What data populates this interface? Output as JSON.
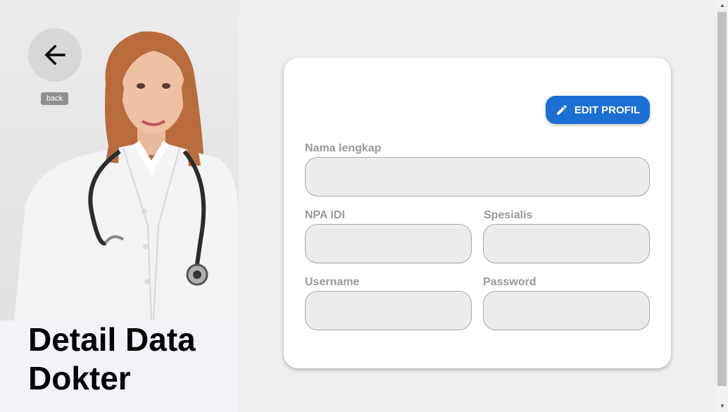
{
  "back": {
    "tooltip": "back"
  },
  "page": {
    "title": "Detail Data Dokter"
  },
  "toolbar": {
    "edit_label": "EDIT PROFIL"
  },
  "form": {
    "nama_label": "Nama lengkap",
    "nama_value": "",
    "npa_label": "NPA IDI",
    "npa_value": "",
    "spesialis_label": "Spesialis",
    "spesialis_value": "",
    "username_label": "Username",
    "username_value": "",
    "password_label": "Password",
    "password_value": ""
  },
  "colors": {
    "accent": "#1c6fd3",
    "input_bg": "#ececec",
    "page_bg": "#efefef"
  },
  "icons": {
    "back": "arrow-left-icon",
    "edit": "pencil-icon",
    "photo": "doctor-photo"
  }
}
